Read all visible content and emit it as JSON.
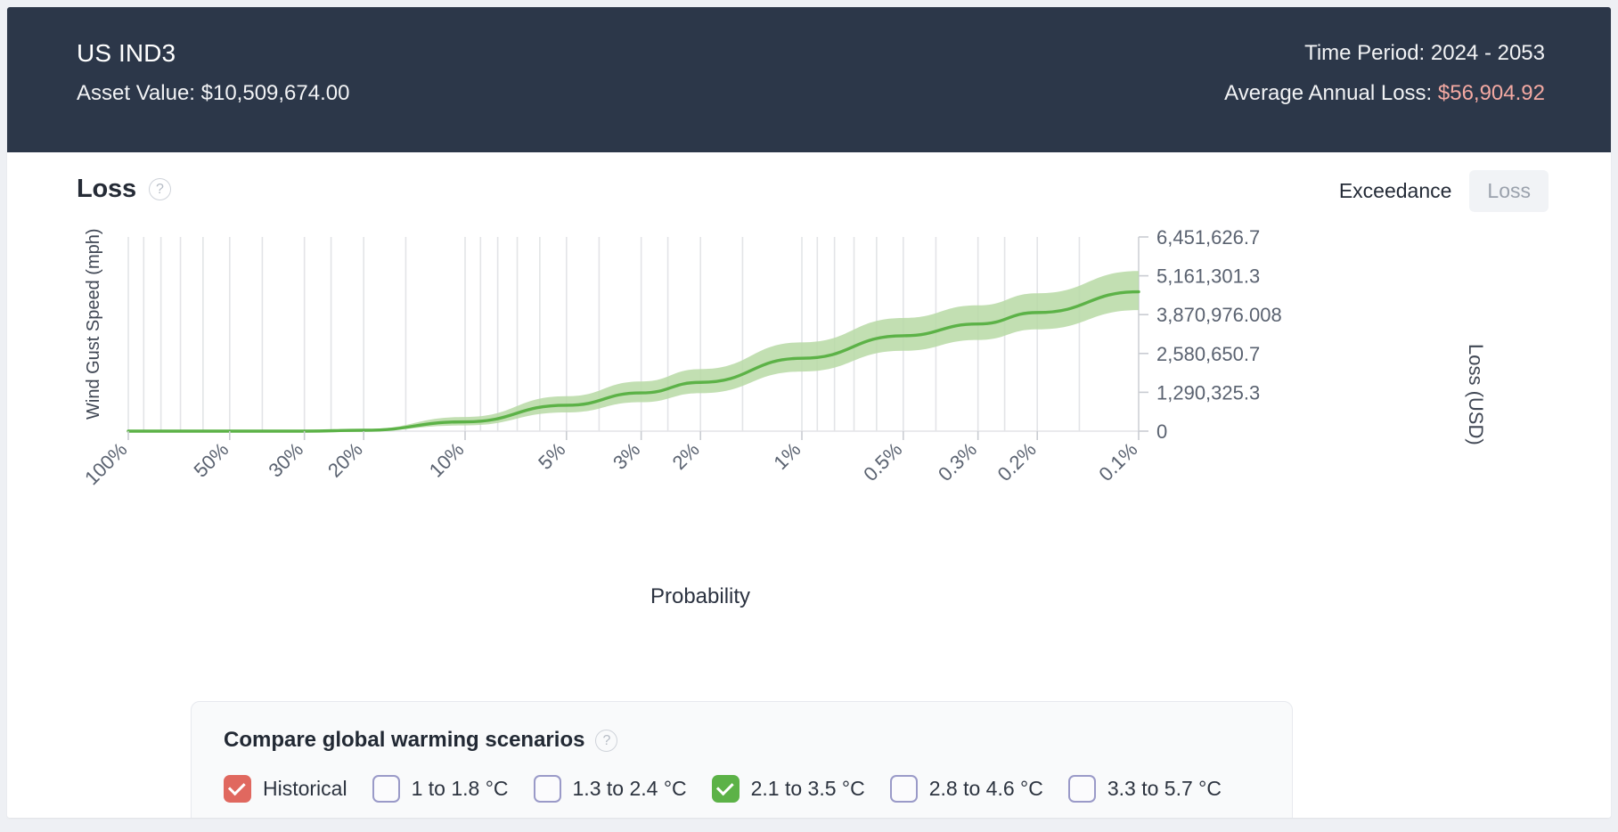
{
  "header": {
    "title": "US IND3",
    "asset_value_label": "Asset Value: $10,509,674.00",
    "time_period_label": "Time Period: 2024 - 2053",
    "average_annual_loss_prefix": "Average Annual Loss: ",
    "average_annual_loss_value": "$56,904.92",
    "background_color": "#2c3749",
    "accent_color": "#f3a9a2"
  },
  "panel": {
    "title": "Loss",
    "help_icon": "question-mark-circle-icon",
    "toggle": {
      "exceedance_label": "Exceedance",
      "loss_label": "Loss",
      "active": "Exceedance"
    }
  },
  "legend": {
    "title": "Compare global warming scenarios",
    "help_icon": "question-mark-circle-icon",
    "items": [
      {
        "label": "Historical",
        "checked": true,
        "color": "#e0685f"
      },
      {
        "label": "1 to 1.8 °C",
        "checked": false,
        "color": "#9a9ac8"
      },
      {
        "label": "1.3 to 2.4 °C",
        "checked": false,
        "color": "#9a9ac8"
      },
      {
        "label": "2.1 to 3.5 °C",
        "checked": true,
        "color": "#5cb247"
      },
      {
        "label": "2.8 to 4.6 °C",
        "checked": false,
        "color": "#9a9ac8"
      },
      {
        "label": "3.3 to 5.7 °C",
        "checked": false,
        "color": "#9a9ac8"
      }
    ]
  },
  "chart_data": {
    "type": "line",
    "title": "Loss",
    "xlabel": "Probability",
    "ylabel": "Wind Gust Speed (mph)",
    "y2label": "Loss (USD)",
    "grid": true,
    "legend_position": "below",
    "x_tick_labels": [
      "100%",
      "50%",
      "30%",
      "20%",
      "10%",
      "5%",
      "3%",
      "2%",
      "1%",
      "0.5%",
      "0.3%",
      "0.2%",
      "0.1%"
    ],
    "x_tick_positions": [
      0,
      0.1415,
      0.2085,
      0.2577,
      0.4,
      0.5415,
      0.6085,
      0.6577,
      0.8,
      0.9415,
      1.0,
      1.0,
      1.0
    ],
    "y_tick_labels": [
      "6,451,626.7",
      "5,161,301.3",
      "3,870,976.008",
      "2,580,650.7",
      "1,290,325.3",
      "0"
    ],
    "y_tick_values": [
      6451626.7,
      5161301.3,
      3870976.008,
      2580650.7,
      1290325.3,
      0
    ],
    "ylim": [
      0,
      6451626.7
    ],
    "series": [
      {
        "name": "2.1 to 3.5 °C",
        "color": "#5cb247",
        "band_color": "#b7d9a4",
        "x": [
          "100%",
          "50%",
          "30%",
          "20%",
          "10%",
          "5%",
          "3%",
          "2%",
          "1%",
          "0.5%",
          "0.3%",
          "0.2%",
          "0.1%"
        ],
        "median": [
          0,
          0,
          0,
          30000,
          310000,
          860000,
          1270000,
          1620000,
          2420000,
          3170000,
          3560000,
          3940000,
          4630000
        ],
        "lower": [
          0,
          0,
          0,
          10000,
          190000,
          620000,
          960000,
          1260000,
          1980000,
          2670000,
          3030000,
          3380000,
          4020000
        ],
        "upper": [
          0,
          0,
          0,
          70000,
          470000,
          1160000,
          1650000,
          2060000,
          2950000,
          3760000,
          4180000,
          4580000,
          5320000
        ]
      }
    ]
  }
}
